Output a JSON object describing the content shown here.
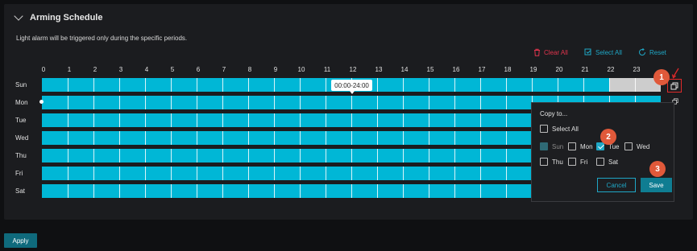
{
  "section": {
    "title": "Arming Schedule",
    "description": "Light alarm will be triggered only during the specific periods."
  },
  "toolbar": {
    "clear_all": "Clear All",
    "select_all": "Select All",
    "reset": "Reset"
  },
  "hours": [
    "0",
    "1",
    "2",
    "3",
    "4",
    "5",
    "6",
    "7",
    "8",
    "9",
    "10",
    "11",
    "12",
    "13",
    "14",
    "15",
    "16",
    "17",
    "18",
    "19",
    "20",
    "21",
    "22",
    "23"
  ],
  "days": [
    "Sun",
    "Mon",
    "Tue",
    "Wed",
    "Thu",
    "Fri",
    "Sat"
  ],
  "tooltip": "00:00-24:00",
  "copy_popover": {
    "title": "Copy to...",
    "select_all": "Select All",
    "days": [
      {
        "label": "Sun",
        "checked": true,
        "disabled": true
      },
      {
        "label": "Mon",
        "checked": false
      },
      {
        "label": "Tue",
        "checked": true
      },
      {
        "label": "Wed",
        "checked": false
      },
      {
        "label": "Thu",
        "checked": false
      },
      {
        "label": "Fri",
        "checked": false
      },
      {
        "label": "Sat",
        "checked": false
      }
    ],
    "cancel": "Cancel",
    "save": "Save"
  },
  "annotations": [
    "1",
    "2",
    "3"
  ],
  "apply": "Apply",
  "colors": {
    "accent": "#00b7d6",
    "danger": "#e2344d",
    "annotation": "#e0593a"
  }
}
